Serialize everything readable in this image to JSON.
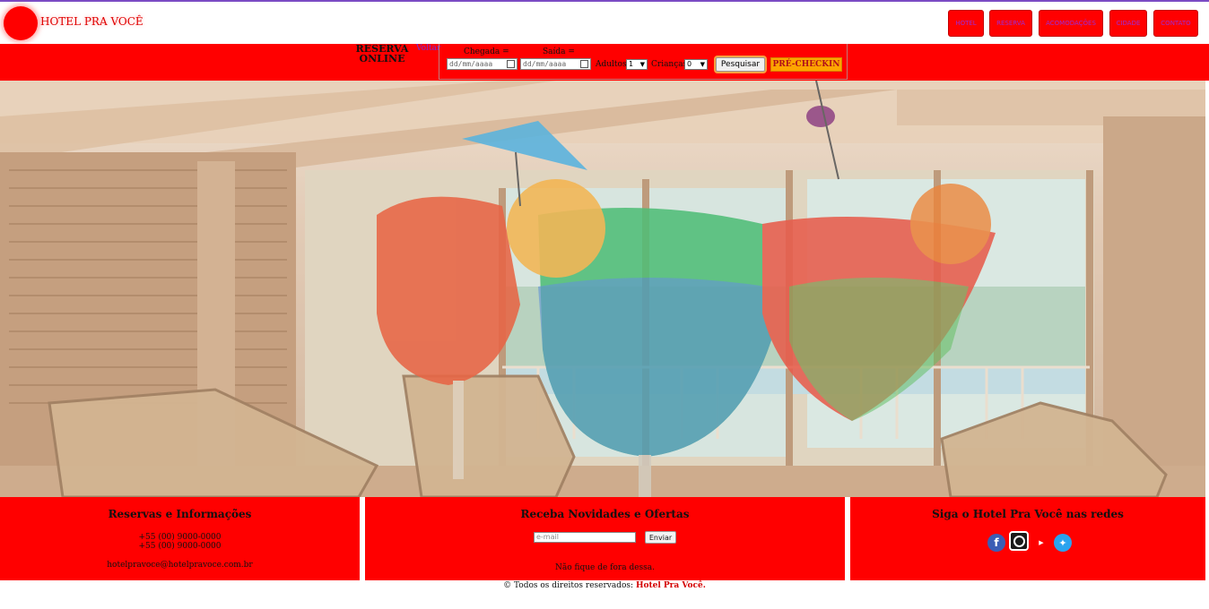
{
  "header": {
    "brand": "HOTEL PRA VOCÊ",
    "nav": [
      "HOTEL",
      "RESERVA",
      "ACOMODAÇÕES",
      "CIDADE",
      "CONTATO"
    ]
  },
  "reservation": {
    "title_line1": "RESERVA",
    "title_line2": "ONLINE",
    "back_link": "Voltar",
    "checkin_label": "Chegada =",
    "checkout_label": "Saída =",
    "date_placeholder": "dd/mm/aaaa",
    "adults_label": "Adultos",
    "adults_value": "1",
    "children_label": "Crianças",
    "children_value": "0",
    "search_button": "Pesquisar",
    "precheckin_button": "PRÉ-CHECKIN"
  },
  "footer": {
    "info": {
      "title": "Reservas e Informações",
      "phone1": "+55 (00) 9000-0000",
      "phone2": "+55 (00) 9000-0000",
      "email": "hotelpravoce@hotelpravoce.com.br"
    },
    "newsletter": {
      "title": "Receba Novidades e Ofertas",
      "email_placeholder": "e-mail",
      "send_button": "Enviar",
      "tagline": "Não fique de fora dessa."
    },
    "social": {
      "title": "Siga o Hotel Pra Você nas redes",
      "icons": [
        "facebook-icon",
        "instagram-icon",
        "youtube-icon",
        "twitter-icon"
      ]
    },
    "copyright_prefix": "© Todos os direitos reservados:",
    "copyright_brand": "Hotel Pra Você."
  },
  "colors": {
    "brand_red": "#ff0000",
    "accent_orange": "#ffa500",
    "link_purple": "#7a2bd6"
  }
}
